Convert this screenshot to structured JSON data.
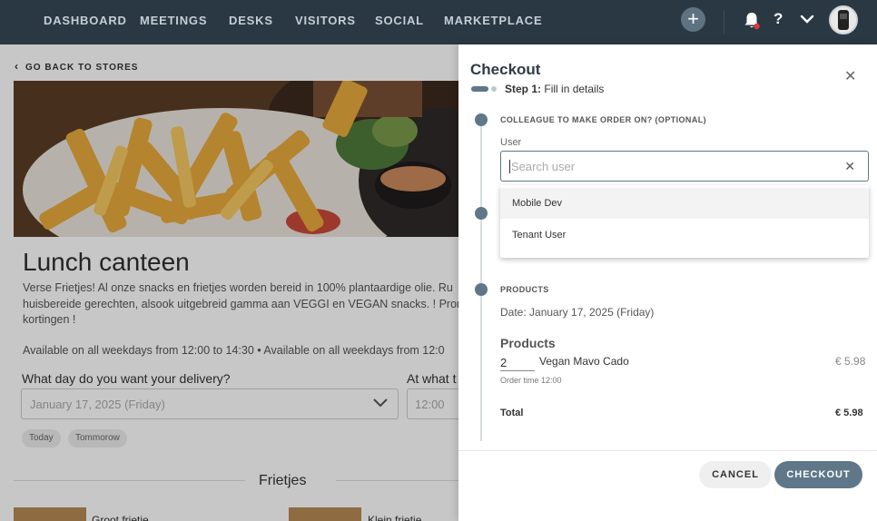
{
  "nav": {
    "items": [
      "DASHBOARD",
      "MEETINGS",
      "DESKS",
      "VISITORS",
      "SOCIAL",
      "MARKETPLACE"
    ],
    "help_label": "?",
    "plus_label": "+"
  },
  "store": {
    "back_label": "GO BACK TO STORES",
    "title": "Lunch canteen",
    "description_lines": [
      "Verse Frietjes! Al onze snacks en frietjes worden bereid in 100% plantaardige olie. Ru",
      "huisbereide gerechten, alsook uitgebreid gamma aan VEGGI en VEGAN snacks. ! Pron",
      "kortingen !"
    ],
    "hours": "Available on all weekdays from 12:00 to 14:30 • Available on all weekdays from 12:0",
    "day_question": "What day do you want your delivery?",
    "time_question": "At what t",
    "date_value": "January 17, 2025 (Friday)",
    "time_value": "12:00",
    "chips": [
      "Today",
      "Tommorow"
    ],
    "section_title": "Frietjes",
    "products": [
      "Groot frietje",
      "Klein frietje"
    ]
  },
  "checkout": {
    "title": "Checkout",
    "step_prefix": "Step 1:",
    "step_text": "Fill in details",
    "colleague_heading": "COLLEAGUE TO MAKE ORDER ON? (OPTIONAL)",
    "user_label": "User",
    "search_placeholder": "Search user",
    "dropdown_options": [
      "Mobile Dev",
      "Tenant User"
    ],
    "products_heading": "PRODUCTS",
    "date_text": "Date: January 17, 2025 (Friday)",
    "products_title": "Products",
    "line": {
      "qty": "2",
      "name": "Vegan Mavo Cado",
      "price": "€ 5.98",
      "order_time": "Order time 12:00"
    },
    "total_label": "Total",
    "total_value": "€ 5.98",
    "cancel_label": "CANCEL",
    "checkout_label": "CHECKOUT"
  },
  "colors": {
    "nav_bg": "#2a3843",
    "accent": "#5f7788"
  }
}
